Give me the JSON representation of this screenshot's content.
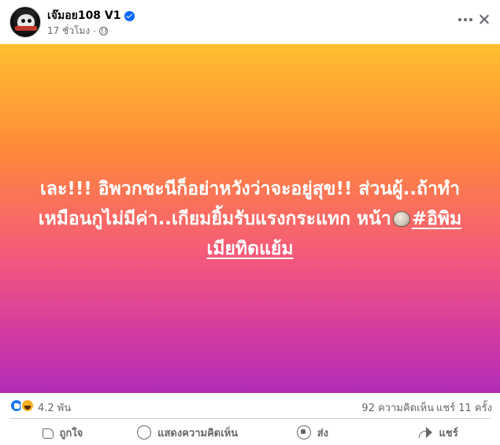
{
  "post": {
    "author": "เจ๊มอย108 V1",
    "time": "17 ชั่วโมง",
    "text": "เละ!!! อิพวกชะนีก็อย่าหวังว่าจะอยู่สุข!! ส่วนผู้..ถ้าทำเหมือนกูไม่มีค่า..เกียมยิ้มรับแรงกระแทก หน้า",
    "emoji": "oyster",
    "hashtag": "#อิพิมเมียทิดแย้ม",
    "background": [
      "#ffbf2f",
      "#ff8a3a",
      "#f4577d",
      "#b12cb6"
    ]
  },
  "stats": {
    "reactions": "4.2 พัน",
    "comments": "92 ความคิดเห็น",
    "shares": "แชร์ 11 ครั้ง"
  },
  "actions": {
    "like": "ถูกใจ",
    "comment": "แสดงความคิดเห็น",
    "send": "ส่ง",
    "share": "แชร์"
  },
  "icons": [
    "more-icon",
    "close-icon",
    "verified-badge-icon",
    "globe-icon",
    "like-reaction-icon",
    "haha-reaction-icon",
    "like-icon",
    "comment-icon",
    "whatsapp-icon",
    "share-icon"
  ],
  "colors": {
    "accent": "#0866ff",
    "muted": "#65676b"
  }
}
